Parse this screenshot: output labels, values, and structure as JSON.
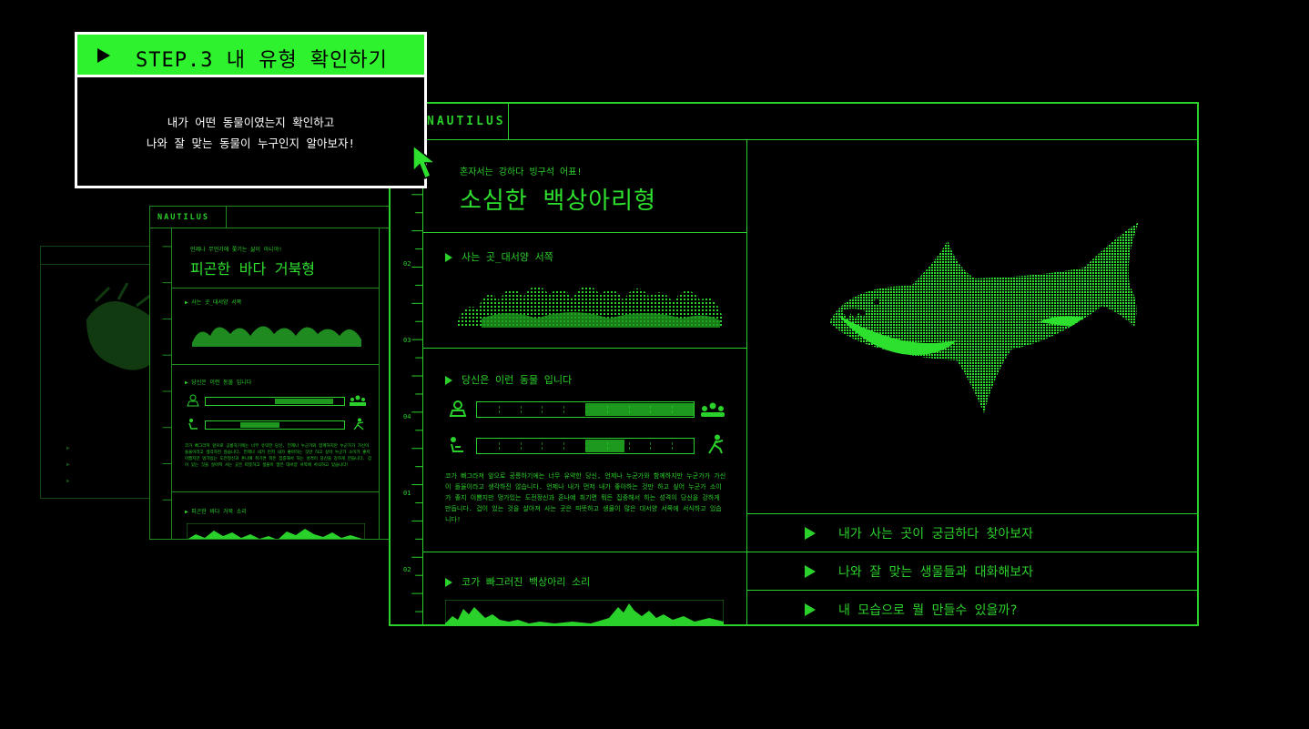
{
  "popup": {
    "title": "STEP.3 내 유형 확인하기",
    "line1": "내가 어떤 동물이였는지 확인하고",
    "line2": "나와 잘 맞는 동물이 누구인지 알아보자!"
  },
  "mid_panel": {
    "logo": "NAUTILUS",
    "tagline": "언제나 무언가에 쫓기는 삶이 아니야!",
    "title": "피곤한 바다 거북형",
    "habitat_label": "사는 곳_대서양 서쪽",
    "animal_label": "당신은 이런 동물 입니다",
    "sound_label": "피곤한 바다 거북 소리",
    "meter1_fill": 0.42,
    "meter2_fill": 0.28
  },
  "main_panel": {
    "logo": "NAUTILUS",
    "tagline": "혼자서는 강하다 빙구석 어표!",
    "title": "소심한 백상아리형",
    "habitat_label": "사는 곳_대서양 서쪽",
    "animal_label": "당신은 이런 동물 입니다",
    "description": "코가 빠그라져 앞으로 공릉하기에는 너무 유약한 당신, 언제나 누군가와 함께하지만 누군가가 가신이 돌율이라고 생각하진 않습니다. 언제나 내가 먼저 내가 좋아하는 것만 하고 싶어 누군가 소이가 좋지 이쁨지만 멍가있는 도전정신과 혼나예 취기면 뭐든 집중해서 하는 성격이 당신을 강하게 만듭니다. 겁이 있는 것을 살아져 사는 곳은 따뜻하고 생물이 많은 대서양 서쪽에 서식하고 있습니다!",
    "sound_label": "코가 빠그러진 백상아리 소리",
    "meter1_fill": 0.5,
    "meter2_fill": 0.18,
    "ruler_labels": [
      "02",
      "03",
      "04",
      "01",
      "02"
    ]
  },
  "menu": [
    "내가 사는 곳이 궁금하다 찾아보자",
    "나와 잘 맞는 생물들과 대화해보자",
    "내 모습으로 뭘 만들수 있을까?"
  ],
  "colors": {
    "accent": "#2bd12b",
    "popup_bar": "#2ef22e",
    "background": "#000000"
  },
  "icons": [
    "person-icon",
    "group-icon",
    "seated-person-icon",
    "active-person-icon",
    "cursor-arrow-icon",
    "play-triangle-icon"
  ]
}
